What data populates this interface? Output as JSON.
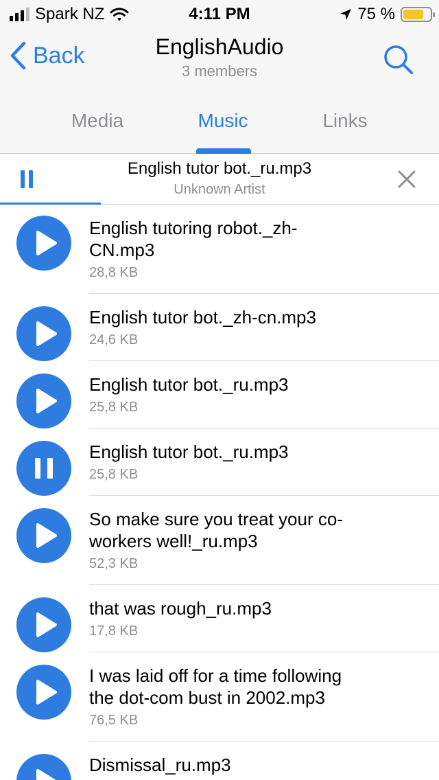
{
  "status": {
    "carrier": "Spark NZ",
    "time": "4:11 PM",
    "battery": "75 %",
    "battery_level": 0.75,
    "battery_color": "#f7c325"
  },
  "nav": {
    "back_label": "Back",
    "title": "EnglishAudio",
    "subtitle": "3 members",
    "search_icon": "search-icon"
  },
  "tabs": [
    {
      "label": "Media",
      "active": false
    },
    {
      "label": "Music",
      "active": true
    },
    {
      "label": "Links",
      "active": false
    }
  ],
  "player": {
    "title": "English tutor bot._ru.mp3",
    "artist": "Unknown Artist",
    "state": "playing",
    "progress": 0.23
  },
  "tracks": [
    {
      "title": "English tutoring robot._zh-\nCN.mp3",
      "size": "28,8 KB",
      "state": "play"
    },
    {
      "title": "English tutor bot._zh-cn.mp3",
      "size": "24,6 KB",
      "state": "play"
    },
    {
      "title": "English tutor bot._ru.mp3",
      "size": "25,8 KB",
      "state": "play"
    },
    {
      "title": "English tutor bot._ru.mp3",
      "size": "25,8 KB",
      "state": "pause"
    },
    {
      "title": "So make sure you treat your co-\nworkers well!_ru.mp3",
      "size": "52,3 KB",
      "state": "play"
    },
    {
      "title": "that was rough_ru.mp3",
      "size": "17,8 KB",
      "state": "play"
    },
    {
      "title": "I was laid off for a time following\nthe dot-com bust in 2002.mp3",
      "size": "76,5 KB",
      "state": "play"
    },
    {
      "title": "Dismissal_ru.mp3",
      "size": "",
      "state": "play"
    }
  ],
  "colors": {
    "accent": "#2a7de1",
    "play_button": "#2f7ce0",
    "secondary_text": "#8e8e93"
  }
}
